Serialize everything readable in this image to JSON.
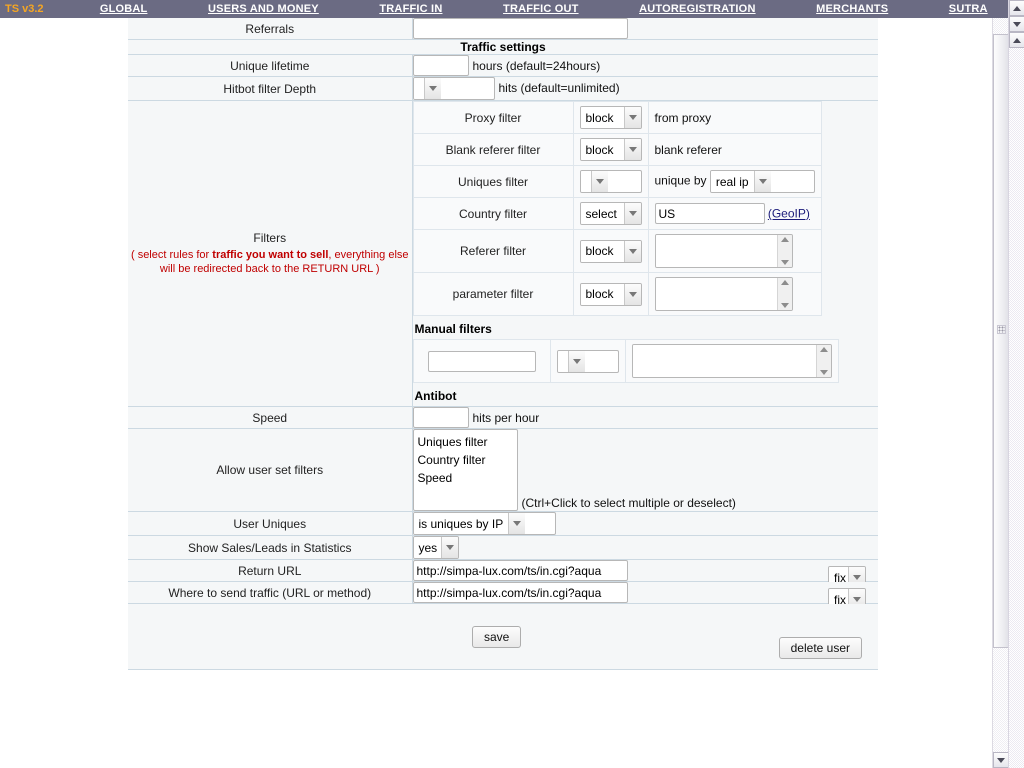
{
  "nav": {
    "logo": "TS v3.2",
    "links": [
      {
        "label": "GLOBAL"
      },
      {
        "label": "USERS AND MONEY"
      },
      {
        "label": "TRAFFIC IN"
      },
      {
        "label": "TRAFFIC OUT"
      },
      {
        "label": "AUTOREGISTRATION"
      },
      {
        "label": "MERCHANTS"
      },
      {
        "label": "SUTRA"
      }
    ]
  },
  "form": {
    "referrals": {
      "label": "Referrals",
      "value": ""
    },
    "section_traffic_settings": "Traffic settings",
    "unique_lifetime": {
      "label": "Unique lifetime",
      "value": "",
      "suffix": "hours (default=24hours)"
    },
    "hitbot_filter_depth": {
      "label": "Hitbot filter Depth",
      "value": "",
      "suffix": "hits (default=unlimited)"
    },
    "filters": {
      "label": "Filters",
      "note_prefix": "( select rules for ",
      "note_bold": "traffic you want to sell",
      "note_suffix": ", everything else will be redirected back to the RETURN URL )",
      "rows": [
        {
          "name": "Proxy filter",
          "select": "block",
          "extra_text": "from proxy"
        },
        {
          "name": "Blank referer filter",
          "select": "block",
          "extra_text": "blank referer"
        },
        {
          "name": "Uniques filter",
          "select": "",
          "extra_text": "unique by",
          "extra_select": "real ip"
        },
        {
          "name": "Country filter",
          "select": "select",
          "extra_input": "US",
          "link": "(GeoIP)"
        },
        {
          "name": "Referer filter",
          "select": "block",
          "textarea": ""
        },
        {
          "name": "parameter filter",
          "select": "block",
          "textarea": ""
        }
      ],
      "manual_filters_title": "Manual filters",
      "manual": {
        "input": "",
        "select": "",
        "textarea": ""
      },
      "antibot_title": "Antibot"
    },
    "speed": {
      "label": "Speed",
      "value": "",
      "suffix": "hits per hour"
    },
    "allow_user_set_filters": {
      "label": "Allow user set filters",
      "options": [
        "Uniques filter",
        "Country filter",
        "Speed"
      ],
      "hint": "(Ctrl+Click to select multiple or deselect)"
    },
    "user_uniques": {
      "label": "User Uniques",
      "value": "is uniques by IP"
    },
    "show_sales_leads": {
      "label": "Show Sales/Leads in Statistics",
      "value": "yes"
    },
    "return_url": {
      "label": "Return URL",
      "value": "http://simpa-lux.com/ts/in.cgi?aqua",
      "mode": "fix"
    },
    "send_traffic": {
      "label": "Where to send traffic (URL or method)",
      "value": "http://simpa-lux.com/ts/in.cgi?aqua",
      "mode": "fix"
    },
    "save_label": "save",
    "delete_label": "delete user"
  },
  "colors": {
    "nav_bg": "#6b6b83",
    "logo": "#f5a623",
    "note_red": "#c00000",
    "row_bg": "#f5f7f8",
    "border": "#ccd9e2",
    "link": "#1a1a7a"
  }
}
